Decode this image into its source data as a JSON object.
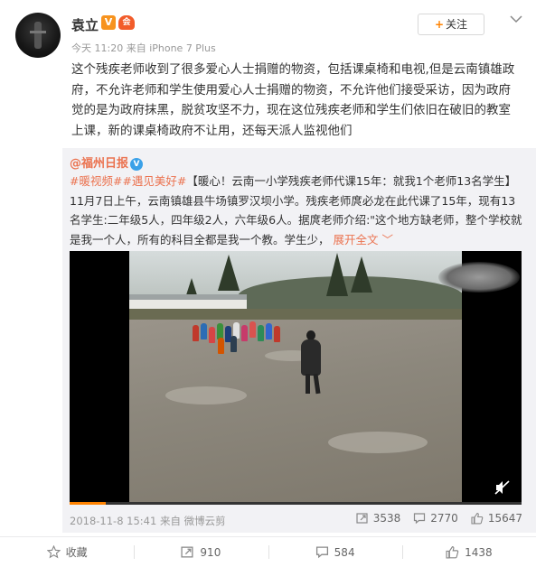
{
  "post": {
    "username": "袁立",
    "v_badge": "V",
    "vip_badge": "会",
    "meta": "今天 11:20 来自 iPhone 7 Plus",
    "follow_plus": "+",
    "follow_label": "关注",
    "text": "这个残疾老师收到了很多爱心人士捐赠的物资，包括课桌椅和电视,但是云南镇雄政府，不允许老师和学生使用爱心人士捐赠的物资，不允许他们接受采访，因为政府觉的是为政府抹黑，脱贫攻坚不力，现在这位残疾老师和学生们依旧在破旧的教室上课，新的课桌椅政府不让用，还每天派人监视他们"
  },
  "repost": {
    "author": "@福州日报",
    "author_badge": "V",
    "tags": "#暖视频##遇见美好#",
    "text_body": "【暖心！云南一小学残疾老师代课15年：就我1个老师13名学生】11月7日上午，云南镇雄县牛场镇罗汉坝小学。残疾老师庹必龙在此代课了15年，现有13名学生:二年级5人，四年级2人，六年级6人。据庹老师介绍:\"这个地方缺老师，整个学校就是我一个人，所有的科目全都是我一个教。学生少，",
    "expand_label": "展开全文",
    "expand_caret": "﹀",
    "video": {
      "progress": 0.08
    },
    "footer": "2018-11-8 15:41 来自 微博云剪",
    "stats": {
      "reposts": "3538",
      "comments": "2770",
      "likes": "15647"
    }
  },
  "actions": {
    "favorite": "收藏",
    "repost": "910",
    "comment": "584",
    "like": "1438"
  },
  "colors": {
    "accent": "#ff8200",
    "link": "#eb7350",
    "repost_bg": "#f2f2f5"
  },
  "icons": [
    "more-chevron-icon",
    "repost-icon",
    "comment-icon",
    "like-icon",
    "star-icon",
    "mute-icon"
  ]
}
